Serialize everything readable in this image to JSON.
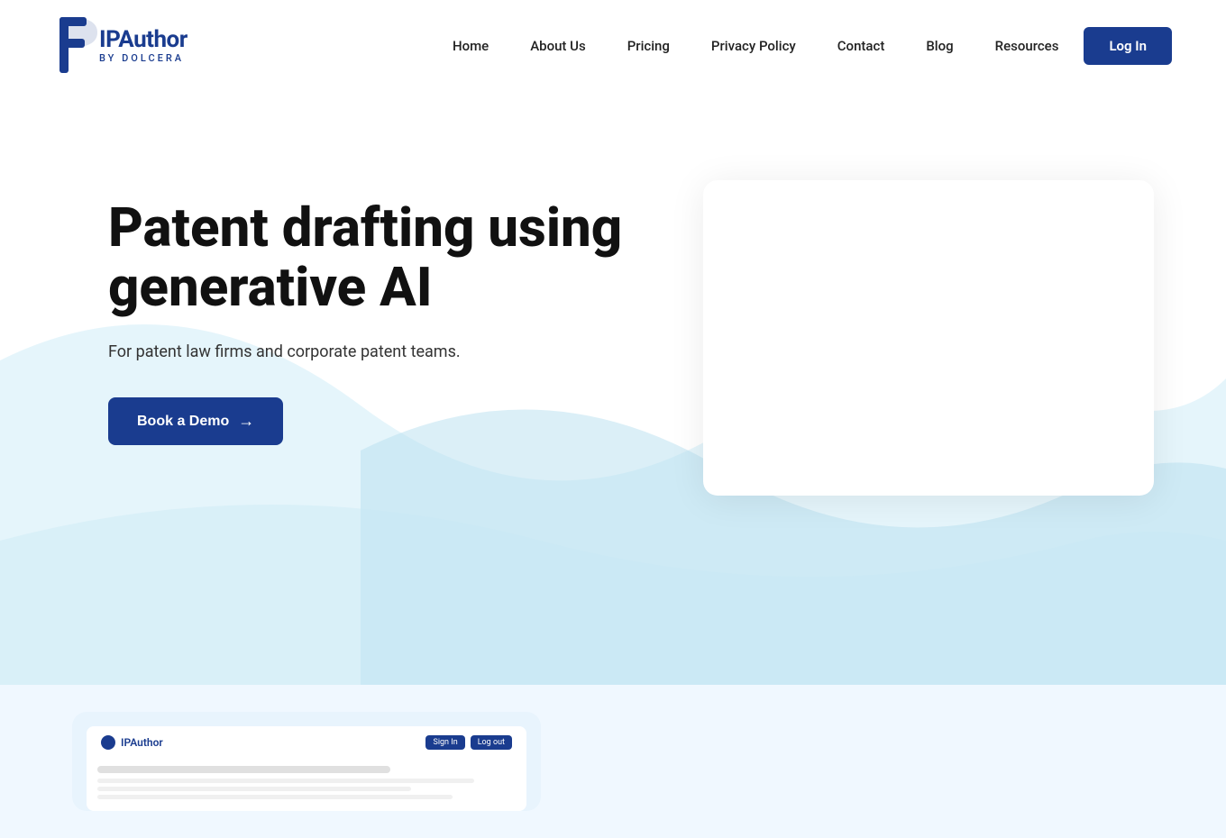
{
  "brand": {
    "logo_main": "IPAuthor",
    "logo_sub": "BY DOLCERA"
  },
  "nav": {
    "links": [
      {
        "label": "Home",
        "id": "home"
      },
      {
        "label": "About Us",
        "id": "about"
      },
      {
        "label": "Pricing",
        "id": "pricing"
      },
      {
        "label": "Privacy Policy",
        "id": "privacy"
      },
      {
        "label": "Contact",
        "id": "contact"
      },
      {
        "label": "Blog",
        "id": "blog"
      },
      {
        "label": "Resources",
        "id": "resources"
      }
    ],
    "login_label": "Log In"
  },
  "hero": {
    "title_line1": "Patent drafting using",
    "title_line2": "generative AI",
    "subtitle": "For patent law firms and corporate patent teams.",
    "cta_label": "Book a Demo",
    "cta_arrow": "→"
  },
  "colors": {
    "primary": "#1a3c8f",
    "bg_light": "#e8f4fb",
    "bg_wave": "#b8dff0"
  }
}
